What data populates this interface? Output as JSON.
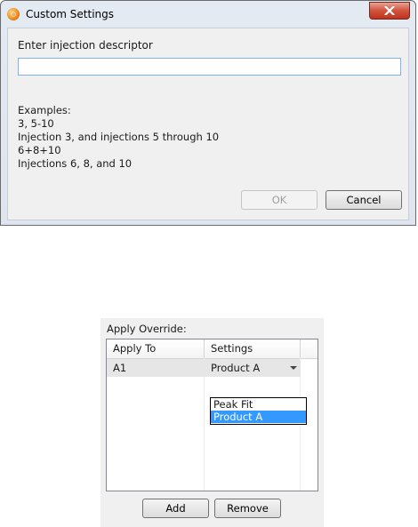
{
  "dialog": {
    "title": "Custom Settings",
    "app_icon": "app-logo-icon",
    "close_icon": "close-icon",
    "prompt": "Enter injection descriptor",
    "input_value": "",
    "examples_heading": "Examples:",
    "examples": [
      "3, 5-10",
      "Injection 3, and injections 5 through 10",
      "6+8+10",
      "Injections 6, 8, and 10"
    ],
    "ok_label": "OK",
    "cancel_label": "Cancel"
  },
  "override": {
    "label": "Apply Override:",
    "columns": [
      "Apply To",
      "Settings"
    ],
    "row": {
      "apply_to": "A1",
      "settings": "Product A"
    },
    "dropdown_options": [
      "Peak Fit",
      "Product A"
    ],
    "selected_option": "Product A",
    "add_label": "Add",
    "remove_label": "Remove"
  }
}
